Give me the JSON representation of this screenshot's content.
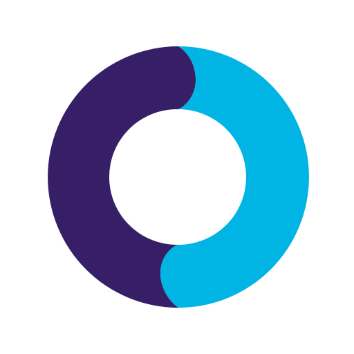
{
  "logo": {
    "icon": "two-tone-ring-logo-icon",
    "colors": {
      "background": "#ffffff",
      "left_segment": "#371F67",
      "right_segment": "#00B4E4",
      "center": "#ffffff"
    }
  }
}
